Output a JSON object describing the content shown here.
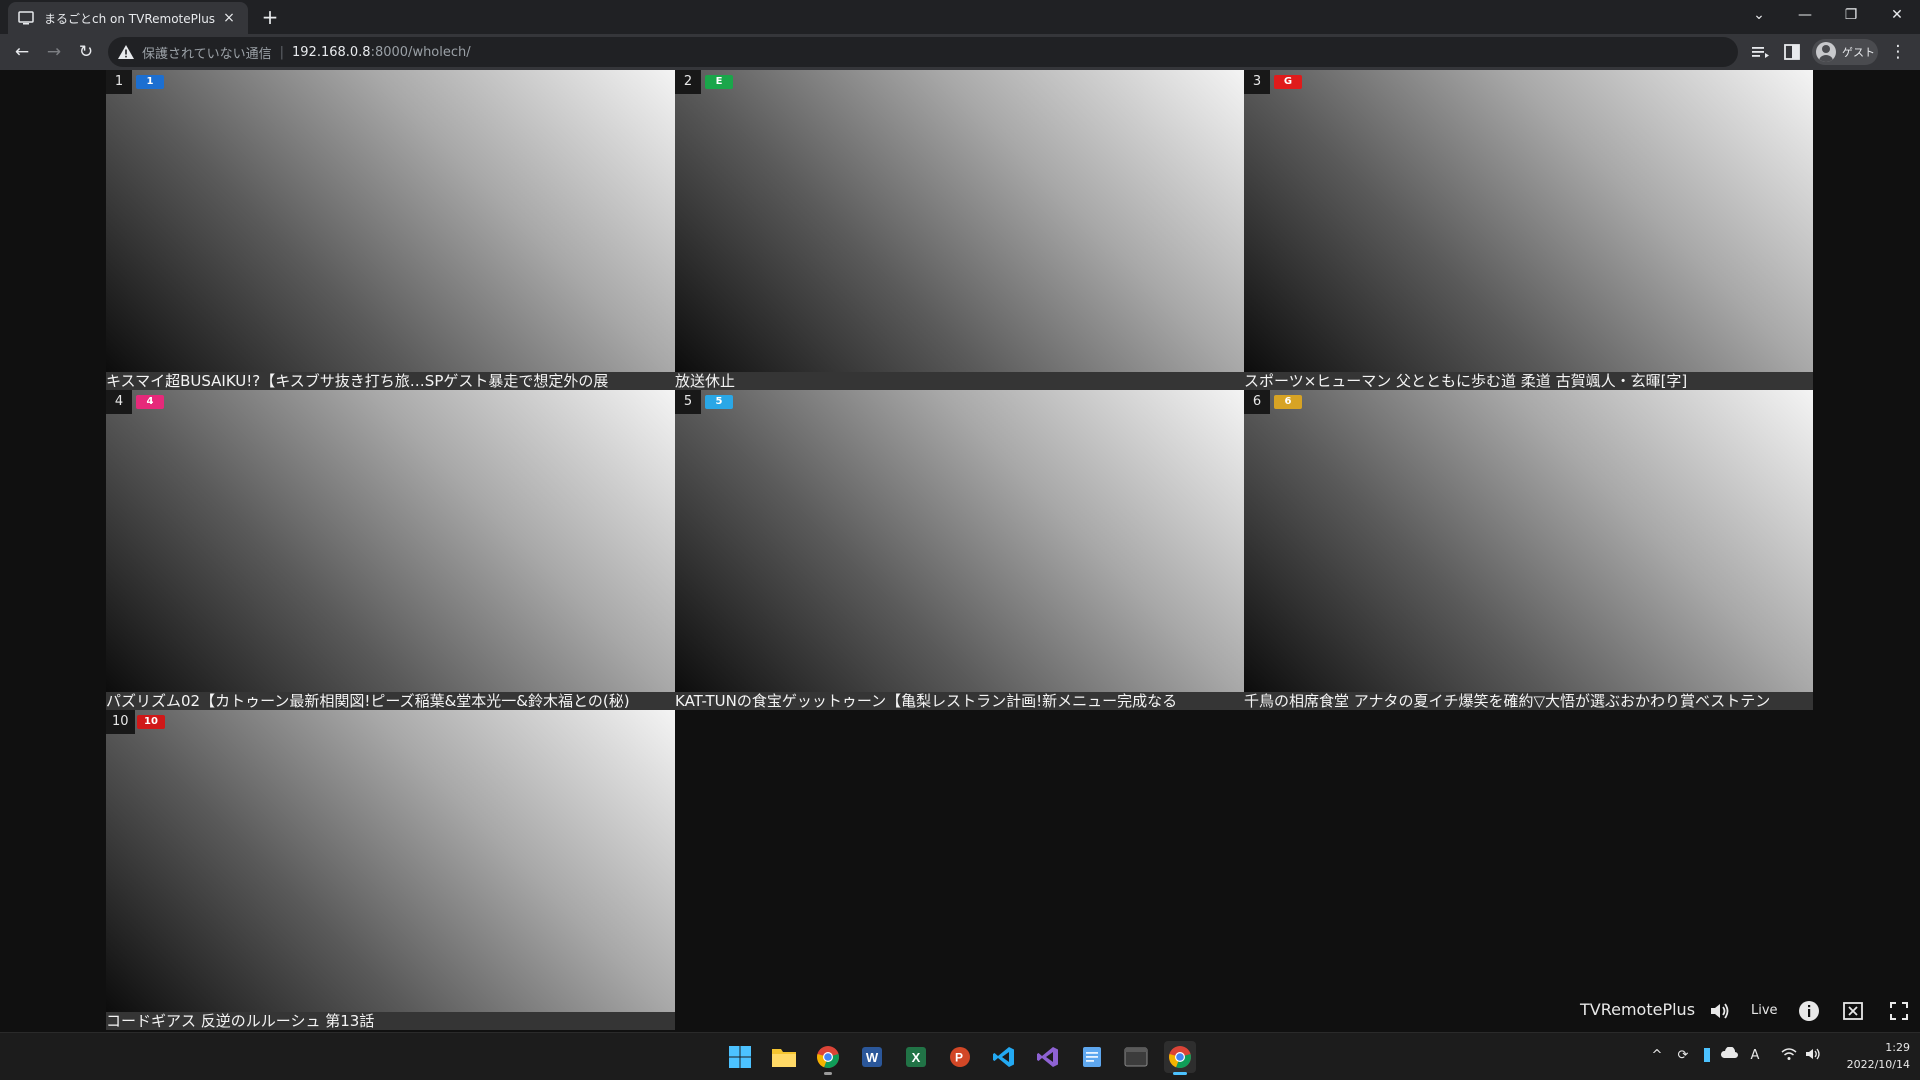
{
  "browser": {
    "tab_title": "まるごとch on TVRemotePlus",
    "tab_close": "×",
    "new_tab": "+",
    "insecure_label": "保護されていない通信",
    "url_host": "192.168.0.8",
    "url_path": ":8000/wholech/",
    "profile_label": "ゲスト"
  },
  "channels": [
    {
      "number": "1",
      "logo_text": "1",
      "logo_color": "#1c6fd1",
      "caption": "キスマイ超BUSAIKU!?【キスブサ抜き打ち旅…SPゲスト暴走で想定外の展"
    },
    {
      "number": "2",
      "logo_text": "E",
      "logo_color": "#1aa64a",
      "caption": "放送休止"
    },
    {
      "number": "3",
      "logo_text": "G",
      "logo_color": "#e01b1b",
      "caption": "スポーツ×ヒューマン 父とともに歩む道 柔道 古賀颯人・玄暉[字]"
    },
    {
      "number": "4",
      "logo_text": "4",
      "logo_color": "#e6297a",
      "caption": "パズリズム02【カトゥーン最新相関図!ピーズ稲葉&堂本光一&鈴木福との(秘)"
    },
    {
      "number": "5",
      "logo_text": "5",
      "logo_color": "#2aa7e6",
      "caption": "KAT-TUNの食宝ゲッットゥーン【亀梨レストラン計画!新メニュー完成なる"
    },
    {
      "number": "6",
      "logo_text": "6",
      "logo_color": "#d7a324",
      "caption": "千鳥の相席食堂 アナタの夏イチ爆笑を確約▽大悟が選ぶおかわり賞ベストテン"
    },
    {
      "number": "10",
      "logo_text": "10",
      "logo_color": "#d01818",
      "caption": "コードギアス 反逆のルルーシュ 第13話"
    }
  ],
  "player": {
    "brand": "TVRemotePlus",
    "live_label": "Live"
  },
  "taskbar": {
    "time": "1:29",
    "date": "2022/10/14"
  }
}
